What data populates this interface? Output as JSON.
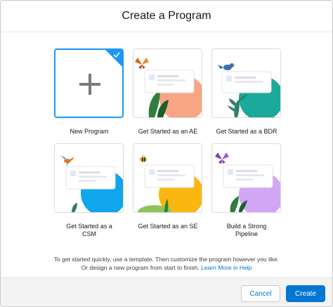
{
  "dialog": {
    "title": "Create a Program"
  },
  "templates": [
    {
      "label": "New Program",
      "selected": true
    },
    {
      "label": "Get Started as an AE",
      "accent": "#f7a583",
      "critter": "butterfly-icon"
    },
    {
      "label": "Get Started as a BDR",
      "accent": "#1aa99a",
      "critter": "bird-icon"
    },
    {
      "label": "Get Started as a CSM",
      "label_line1": "Get Started as a",
      "label_line2": "CSM",
      "accent": "#0fa5ef",
      "critter": "hummingbird-icon"
    },
    {
      "label": "Get Started as an SE",
      "accent": "#fbb60f",
      "critter": "bee-icon"
    },
    {
      "label": "Build a Strong Pipeline",
      "label_line1": "Build a Strong",
      "label_line2": "Pipeline",
      "accent": "#d1a7f5",
      "critter": "purple-butterfly-icon"
    }
  ],
  "description": {
    "line1": "To get started quickly, use a template. Then customize the program however you like.",
    "line2": "Or design a new program from start to finish.",
    "link": "Learn More in Help"
  },
  "buttons": {
    "cancel": "Cancel",
    "create": "Create"
  },
  "colors": {
    "brand": "#0176d3",
    "selection": "#1b96ff"
  }
}
